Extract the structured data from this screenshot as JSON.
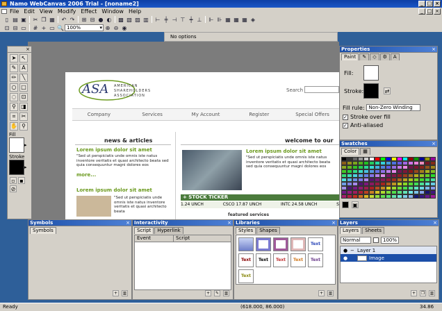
{
  "window": {
    "title": "Namo WebCanvas 2006 Trial - [noname2]"
  },
  "menu": [
    "File",
    "Edit",
    "View",
    "Modify",
    "Effect",
    "Window",
    "Help"
  ],
  "toolbar": {
    "zoom": "100%",
    "options_text": "No options"
  },
  "canvas": {
    "logo_initials": "ASA",
    "logo_lines": [
      "AMERICAN",
      "SHAREHOLDERS",
      "ASSOCIATION"
    ],
    "search_label": "Search",
    "nav": [
      "Company",
      "Services",
      "My Account",
      "Register",
      "Special Offers"
    ],
    "news_heading": "news & articles",
    "welcome_heading": "welcome to our",
    "lorem_title": "Lorem ipsum dolor sit amet",
    "lorem_body": "\"Sed ut perspiciatis unde omnis iste natus inventore veritatis et quasi architecto beata sed quia consequuntur magni dolores eos",
    "lorem_body_short": "\"Sed ut perspiciatis unde omnis iste natus inventore veritatis et quasi architecto beata",
    "more": "more...",
    "stock_ticker": "+ STOCK TICKER",
    "stocks": [
      "1.24 UNCH",
      "CSCO 17.87 UNCH",
      "INTC 24.58 UNCH",
      "S"
    ],
    "featured": "featured services"
  },
  "tools_panel": {
    "fill_label": "Fill",
    "stroke_label": "Stroke"
  },
  "properties": {
    "title": "Properties",
    "tab": "Paint",
    "fill_label": "Fill:",
    "stroke_label": "Stroke:",
    "fill_rule_label": "Fill rule:",
    "fill_rule_value": "Non-Zero Winding",
    "stroke_over_fill": "Stroke over fill",
    "anti_aliased": "Anti-aliased"
  },
  "swatches": {
    "title": "Swatches",
    "tab": "Color",
    "colors": [
      "#000000",
      "#333333",
      "#666666",
      "#999999",
      "#cccccc",
      "#ffffff",
      "#ff0000",
      "#00ff00",
      "#0000ff",
      "#ffff00",
      "#ff00ff",
      "#00ffff",
      "#990000",
      "#009900",
      "#000099",
      "#999900",
      "#990099"
    ]
  },
  "symbols": {
    "title": "Symbols",
    "tab": "Symbols"
  },
  "interactivity": {
    "title": "Interactivity",
    "tabs": [
      "Script",
      "Hyperlink"
    ],
    "columns": [
      "Event",
      "Script"
    ]
  },
  "libraries": {
    "title": "Libraries",
    "tabs": [
      "Styles",
      "Shapes"
    ],
    "text_sample": "Text"
  },
  "layers": {
    "title": "Layers",
    "tabs": [
      "Layers",
      "Sheets"
    ],
    "blend": "Normal",
    "opacity": "100%",
    "items": [
      "Layer 1",
      "Image"
    ]
  },
  "status": {
    "left": "Ready",
    "coords": "(618.000, 86.000)",
    "right": "34.86"
  }
}
